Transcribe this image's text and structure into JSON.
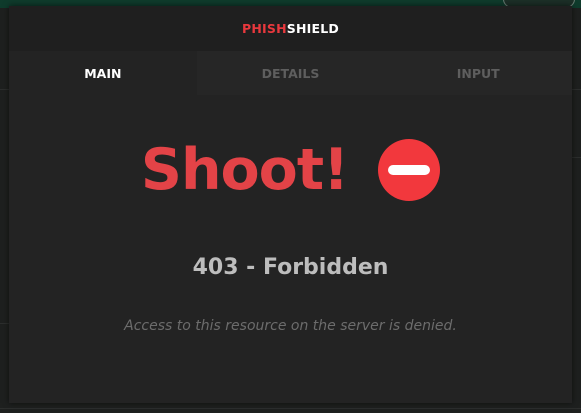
{
  "header": {
    "brand_part1": "PHISH",
    "brand_part2": "SHIELD"
  },
  "tabs": [
    {
      "label": "MAIN",
      "active": true
    },
    {
      "label": "DETAILS",
      "active": false
    },
    {
      "label": "INPUT",
      "active": false
    }
  ],
  "main": {
    "headline": "Shoot!",
    "icon": "stop-icon",
    "error_code": "403 - Forbidden",
    "error_message": "Access to this resource on the server is denied."
  },
  "colors": {
    "accent_red": "#e34347",
    "icon_red": "#f2383d",
    "popup_background": "#232323",
    "header_background": "#1f1f1f"
  }
}
